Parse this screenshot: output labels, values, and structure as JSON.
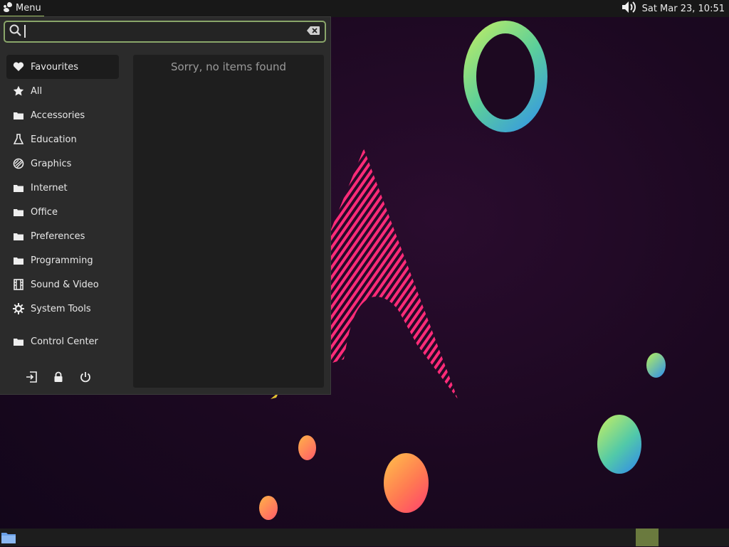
{
  "top_panel": {
    "menu_label": "Menu",
    "clock": "Sat Mar 23, 10:51"
  },
  "menu": {
    "search": {
      "value": "",
      "placeholder": ""
    },
    "categories": [
      {
        "label": "Favourites",
        "icon": "heart-icon"
      },
      {
        "label": "All",
        "icon": "star-icon"
      },
      {
        "label": "Accessories",
        "icon": "folder-icon"
      },
      {
        "label": "Education",
        "icon": "flask-icon"
      },
      {
        "label": "Graphics",
        "icon": "palette-icon"
      },
      {
        "label": "Internet",
        "icon": "folder-icon"
      },
      {
        "label": "Office",
        "icon": "folder-icon"
      },
      {
        "label": "Preferences",
        "icon": "folder-icon"
      },
      {
        "label": "Programming",
        "icon": "folder-icon"
      },
      {
        "label": "Sound & Video",
        "icon": "film-icon"
      },
      {
        "label": "System Tools",
        "icon": "gear-icon"
      },
      {
        "label": "Control Center",
        "icon": "folder-icon"
      }
    ],
    "active_category": "Favourites",
    "results_message": "Sorry, no items found",
    "session_buttons": [
      "logout-icon",
      "lock-icon",
      "power-icon"
    ]
  },
  "colors": {
    "accent": "#9ebd63",
    "panel_bg": "#181818",
    "menu_bg": "#2b2b2b"
  }
}
